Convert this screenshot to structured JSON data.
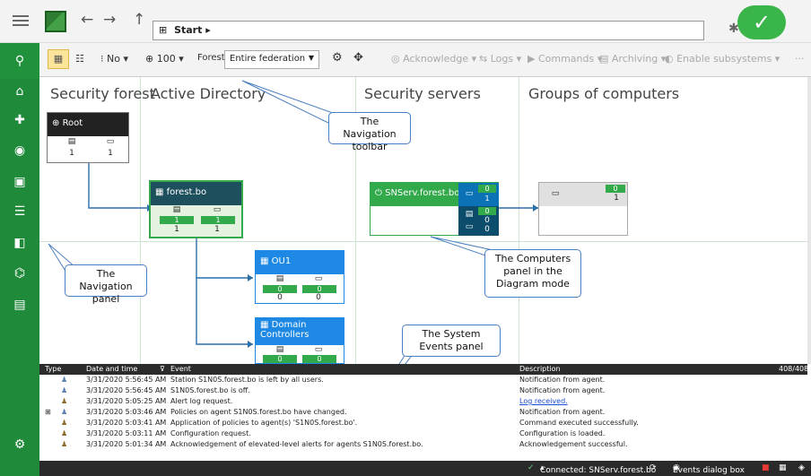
{
  "breadcrumb": {
    "label": "Start",
    "arrow": "▸"
  },
  "toolbar": {
    "no_label": "No",
    "zoom_label": "100",
    "forest_label": "Forest:",
    "forest_value": "Entire federation",
    "acknowledge": "Acknowledge",
    "logs": "Logs",
    "commands": "Commands",
    "archiving": "Archiving",
    "enable_subsystems": "Enable subsystems",
    "more": "···"
  },
  "columns": [
    "Security forest",
    "Active Directory",
    "Security servers",
    "Groups of computers"
  ],
  "nodes": {
    "root": {
      "label": "Root",
      "servers": "1",
      "computers": "1"
    },
    "forest": {
      "label": "forest.bo",
      "servers_bar": "1",
      "computers_bar": "1",
      "servers": "1",
      "computers": "1"
    },
    "ou1": {
      "label": "OU1",
      "servers_bar": "0",
      "computers_bar": "0",
      "servers": "0",
      "computers": "0"
    },
    "dc": {
      "label": "Domain Controllers",
      "servers_bar": "0",
      "computers_bar": "0"
    },
    "snserv": {
      "label": "SNServ.forest.bo",
      "comp_top": "0",
      "comp_bottom": "1",
      "srv_top": "0",
      "srv_mid": "0",
      "srv_bottom": "0"
    },
    "group": {
      "bar": "0",
      "count": "1"
    }
  },
  "callouts": {
    "nav_toolbar": "The Navigation toolbar",
    "nav_panel": "The Navigation panel",
    "computers_panel": "The Computers panel in the Diagram mode",
    "system_events": "The System Events panel"
  },
  "events": {
    "columns": {
      "type": "Type",
      "datetime": "Date and time",
      "event": "Event",
      "description": "Description"
    },
    "count": "408/408",
    "rows": [
      {
        "datetime": "3/31/2020 5:56:45 AM",
        "event": "Station S1N0S.forest.bo is left by all users.",
        "description": "Notification from agent."
      },
      {
        "datetime": "3/31/2020 5:56:45 AM",
        "event": "S1N0S.forest.bo is off.",
        "description": "Notification from agent."
      },
      {
        "datetime": "3/31/2020 5:05:25 AM",
        "event": "Alert log request.",
        "description": "Log received."
      },
      {
        "datetime": "3/31/2020 5:03:46 AM",
        "event": "Policies on agent S1N0S.forest.bo have changed.",
        "description": "Notification from agent."
      },
      {
        "datetime": "3/31/2020 5:03:41 AM",
        "event": "Application of policies to agent(s) 'S1N0S.forest.bo'.",
        "description": "Command executed successfully."
      },
      {
        "datetime": "3/31/2020 5:03:11 AM",
        "event": "Configuration request.",
        "description": "Configuration is loaded."
      },
      {
        "datetime": "3/31/2020 5:01:34 AM",
        "event": "Acknowledgement of elevated-level alerts for agents S1N0S.forest.bo.",
        "description": "Acknowledgement successful."
      }
    ]
  },
  "status": {
    "connected": "Connected: SNServ.forest.bo",
    "events_dialog": "Events dialog box"
  }
}
